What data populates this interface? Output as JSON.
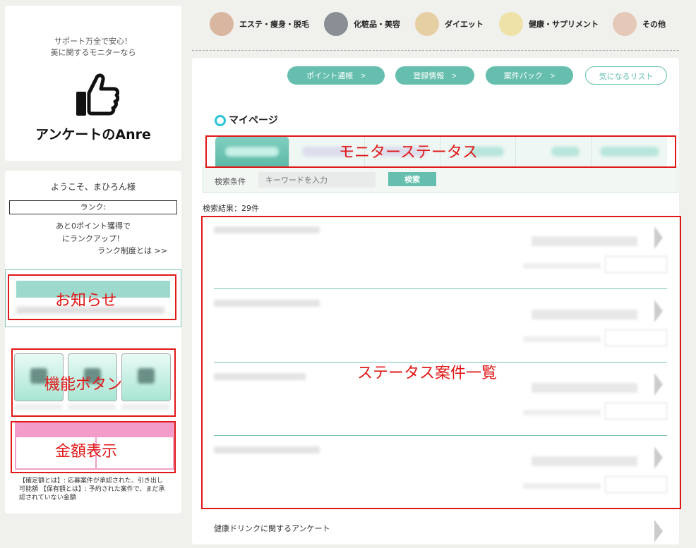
{
  "sidebar": {
    "tagline1": "サポート万全で安心！",
    "tagline2": "美に関するモニターなら",
    "brand": "アンケートのAnre",
    "welcome": "ようこそ、まひろん様",
    "rank_label": "ランク:",
    "rank_note1": "あと0ポイント獲得で",
    "rank_note2": "にランクアップ！",
    "rank_link": "ランク制度とは >>",
    "amount_note": "【確定額とは】: 応募案件が承認された、引き出し可能額 【保有額とは】: 予約された案件で、まだ承認されていない金額"
  },
  "categories": [
    {
      "label": "エステ・痩身・脱毛",
      "color": "#d9b6a0"
    },
    {
      "label": "化粧品・美容",
      "color": "#8a8f96"
    },
    {
      "label": "ダイエット",
      "color": "#e7cfa4"
    },
    {
      "label": "健康・サプリメント",
      "color": "#eee2a8"
    },
    {
      "label": "その他",
      "color": "#e5c8b8"
    }
  ],
  "nav": {
    "points": "ポイント通帳　>",
    "register": "登録情報　>",
    "pack": "案件パック　>",
    "favorites": "気になるリスト"
  },
  "mypage_title": "マイページ",
  "search": {
    "label": "検索条件",
    "placeholder": "キーワードを入力",
    "button": "検索"
  },
  "result_count": "検索結果：29件",
  "last_item_title": "健康ドリンクに関するアンケート",
  "annotations": {
    "monitor_status": "モニターステータス",
    "notice": "お知らせ",
    "function_buttons": "機能ボタン",
    "amount_display": "金額表示",
    "status_list": "ステータス案件一覧"
  },
  "colors": {
    "accent": "#66bfae",
    "pink": "#f39cc9",
    "annotation_red": "#e01818",
    "mypage_icon": "#2cc4d6"
  }
}
